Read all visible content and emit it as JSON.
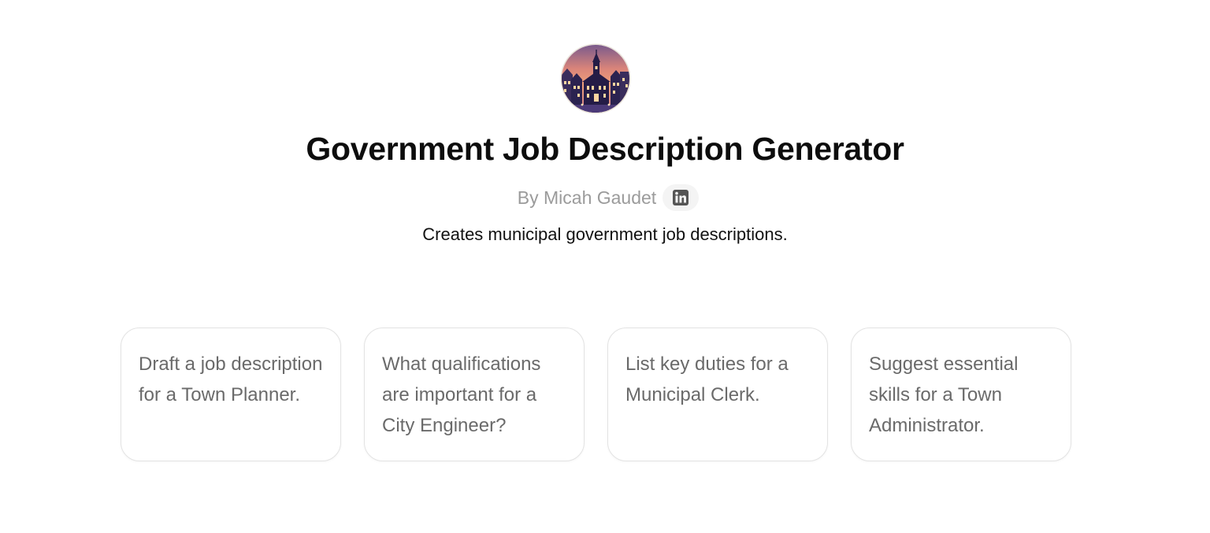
{
  "gpt": {
    "title": "Government Job Description Generator",
    "author_line": "By Micah Gaudet",
    "social_icon": "linkedin-icon",
    "description": "Creates municipal government job descriptions."
  },
  "starters": [
    {
      "text": "Draft a job description for a Town Planner."
    },
    {
      "text": "What qualifications are important for a City Engineer?"
    },
    {
      "text": "List key duties for a Municipal Clerk."
    },
    {
      "text": "Suggest essential skills for a Town Administrator."
    }
  ],
  "colors": {
    "title": "#0d0d0d",
    "byline": "#9b9b9b",
    "starter_text": "#6a6a6a",
    "starter_border": "#e3e3e3",
    "linkedin_badge_bg": "#f4f4f4"
  }
}
